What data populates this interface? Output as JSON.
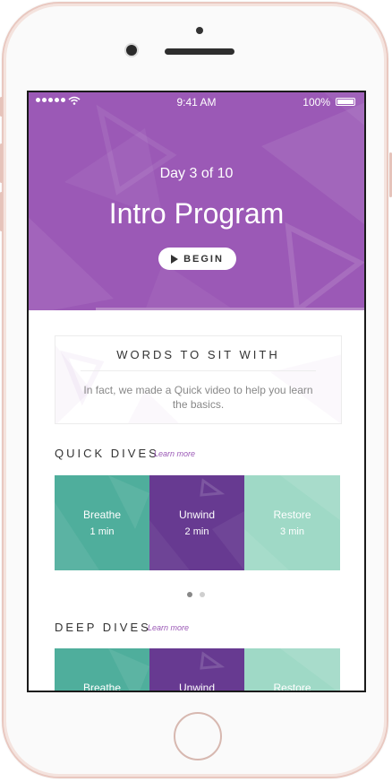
{
  "status_bar": {
    "time": "9:41 AM",
    "battery": "100%"
  },
  "hero": {
    "day": "Day 3 of 10",
    "title": "Intro Program",
    "begin": "BEGIN"
  },
  "words": {
    "title": "WORDS TO SIT WITH",
    "text": "In fact, we made a  Quick video to help you learn the basics."
  },
  "quick_dives": {
    "title": "QUICK DIVES",
    "learn_more": "Learn more",
    "tiles": [
      {
        "name": "Breathe",
        "duration": "1 min",
        "color": "#4fae9c"
      },
      {
        "name": "Unwind",
        "duration": "2 min",
        "color": "#673a91"
      },
      {
        "name": "Restore",
        "duration": "3 min",
        "color": "#9fd9c6"
      }
    ]
  },
  "carousel": {
    "pages": 2,
    "active": 1
  },
  "deep_dives": {
    "title": "DEEP DIVES",
    "learn_more": "Learn more",
    "tiles": [
      {
        "name": "Breathe",
        "color": "#4fae9c"
      },
      {
        "name": "Unwind",
        "color": "#673a91"
      },
      {
        "name": "Restore",
        "color": "#9fd9c6"
      }
    ]
  },
  "colors": {
    "accent": "#9b59b6",
    "teal": "#4fae9c",
    "purple": "#673a91",
    "mint": "#9fd9c6"
  }
}
